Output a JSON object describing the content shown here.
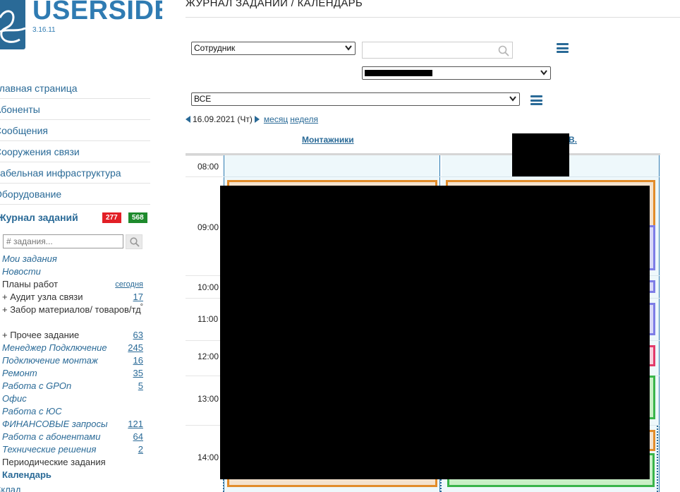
{
  "app": {
    "logo_text": "USERSIDE",
    "version": "3.16.11"
  },
  "sidebar": {
    "menu": [
      {
        "label": "Главная страница"
      },
      {
        "label": "Абоненты"
      },
      {
        "label": "Сообщения"
      },
      {
        "label": "Сооружения связи"
      },
      {
        "label": "Кабельная инфраструктура"
      },
      {
        "label": "Оборудование"
      }
    ],
    "journal": {
      "label": "Журнал заданий",
      "badge_red": "277",
      "badge_green": "568"
    },
    "task_search_placeholder": "# задания...",
    "tasks": [
      {
        "label": "Мои задания",
        "count": ""
      },
      {
        "label": "Новости",
        "count": ""
      },
      {
        "label": "Планы работ",
        "count": "сегодня"
      },
      {
        "label": "+ Аудит узла связи",
        "count": "17"
      },
      {
        "label": "+ Забор материалов/ товаров/тд",
        "count": "°"
      },
      {
        "label": "+ Прочее задание",
        "count": "63"
      },
      {
        "label": "Менеджер Подключение",
        "count": "245"
      },
      {
        "label": "Подключение монтаж",
        "count": "16"
      },
      {
        "label": "Ремонт",
        "count": "35"
      },
      {
        "label": "Работа с GPOn",
        "count": "5"
      },
      {
        "label": "Офис",
        "count": ""
      },
      {
        "label": "Работа с ЮС",
        "count": ""
      },
      {
        "label": "ФИНАНСОВЫЕ запросы",
        "count": "121"
      },
      {
        "label": "Работа с абонентами",
        "count": "64"
      },
      {
        "label": "Технические решения",
        "count": "2"
      },
      {
        "label": "Периодические задания",
        "count": ""
      },
      {
        "label": "Календарь",
        "count": ""
      }
    ],
    "bottom_label": "Склад"
  },
  "main": {
    "title": "ЖУРНАЛ ЗАДАНИЙ / КАЛЕНДАРЬ",
    "employee_select": "Сотрудник",
    "search_value": "",
    "person_select": "",
    "filter_select": "ВСЕ",
    "date_label": "16.09.2021 (Чт)",
    "view_month": "месяц",
    "view_week": "неделя",
    "columns": [
      {
        "label": "Монтажники"
      },
      {
        "label": "В."
      }
    ],
    "times": [
      "08:00",
      "09:00",
      "10:00",
      "11:00",
      "12:00",
      "13:00",
      "14:00"
    ]
  },
  "colors": {
    "brand": "#2a6a97",
    "badge_red": "#e21f26",
    "badge_green": "#1e8a2d",
    "event_orange": "#e28c2a",
    "event_green": "#39b54a",
    "event_pink": "#e23a6a",
    "event_purple": "#7d7de6",
    "calendar_bg": "#eef8fb"
  }
}
